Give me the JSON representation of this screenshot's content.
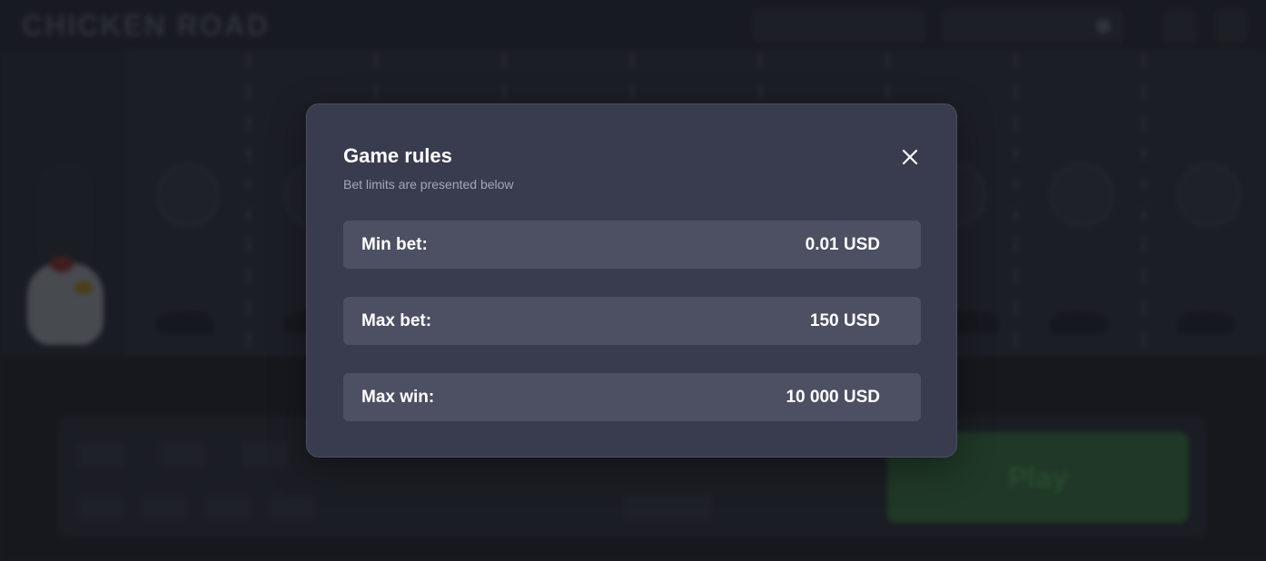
{
  "header": {
    "logo_text": "CHICKEN ROAD"
  },
  "modal": {
    "title": "Game rules",
    "subtitle": "Bet limits are presented below",
    "close_icon": "close-icon",
    "limits": [
      {
        "label": "Min bet:",
        "value": "0.01 USD"
      },
      {
        "label": "Max bet:",
        "value": "150 USD"
      },
      {
        "label": "Max win:",
        "value": "10 000 USD"
      }
    ]
  },
  "controls": {
    "play_label": "Play"
  },
  "colors": {
    "modal_bg": "#393c4f",
    "row_bg": "#4d5063",
    "page_bg": "#23252d",
    "play_green": "#2f5a37"
  }
}
